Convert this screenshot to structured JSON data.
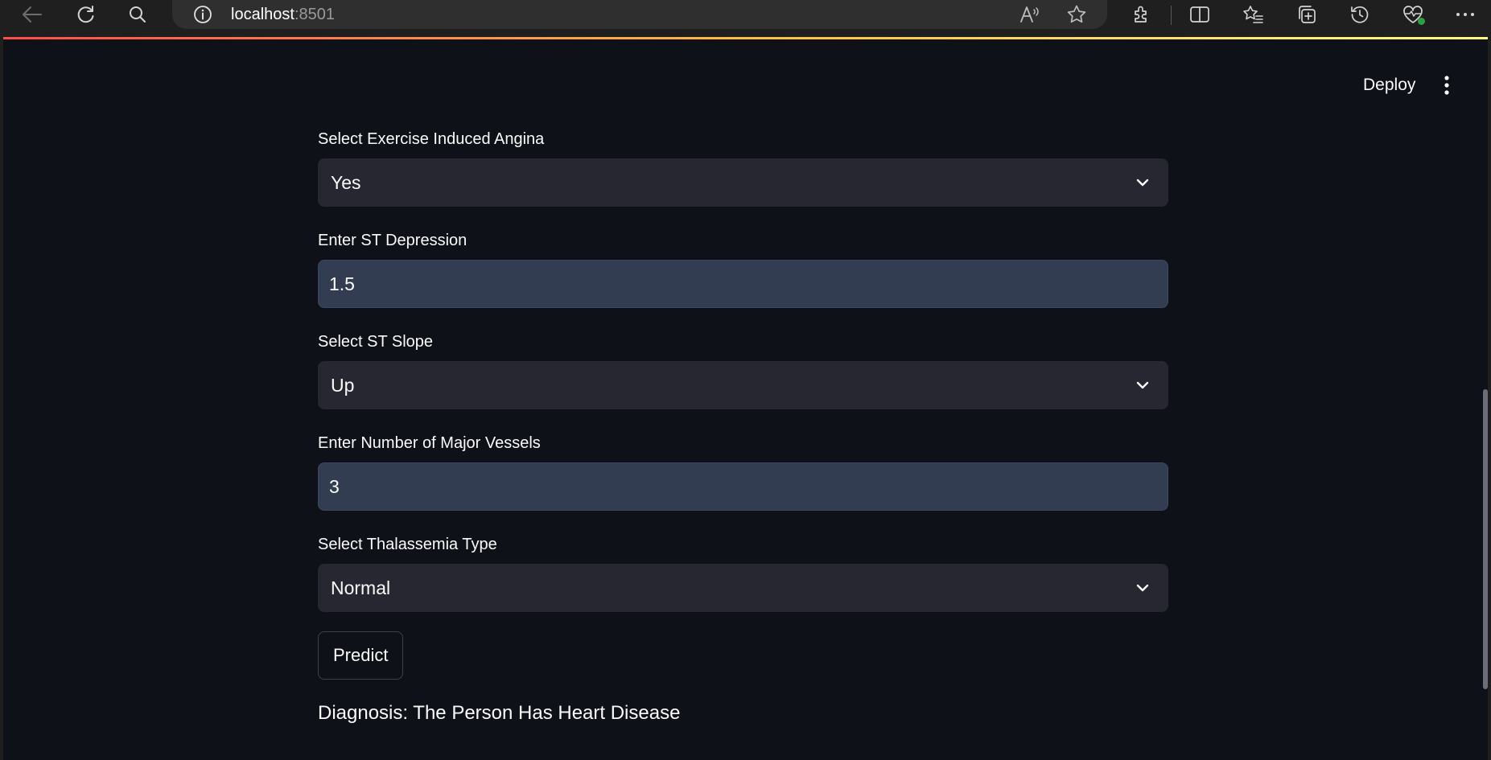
{
  "browser": {
    "url_host": "localhost",
    "url_port": ":8501",
    "icons": [
      "back-icon",
      "refresh-icon",
      "search-icon",
      "site-info-icon",
      "read-aloud-icon",
      "favorite-star-icon",
      "extensions-icon",
      "split-screen-icon",
      "favorites-icon",
      "collections-icon",
      "history-icon",
      "browser-essentials-icon",
      "more-options-icon"
    ]
  },
  "toolbar": {
    "deploy_label": "Deploy"
  },
  "colors": {
    "page_background": "#0e1117",
    "select_background": "#262730",
    "input_background": "#333d52",
    "text": "#fafafa",
    "accent_gradient_start": "#ff4b4b",
    "accent_gradient_end": "#fffd80"
  },
  "form": {
    "exercise_angina": {
      "label": "Select Exercise Induced Angina",
      "value": "Yes"
    },
    "st_depression": {
      "label": "Enter ST Depression",
      "value": "1.5"
    },
    "st_slope": {
      "label": "Select ST Slope",
      "value": "Up"
    },
    "major_vessels": {
      "label": "Enter Number of Major Vessels",
      "value": "3"
    },
    "thalassemia": {
      "label": "Select Thalassemia Type",
      "value": "Normal"
    },
    "predict_label": "Predict"
  },
  "result": {
    "diagnosis": "Diagnosis: The Person Has Heart Disease"
  }
}
